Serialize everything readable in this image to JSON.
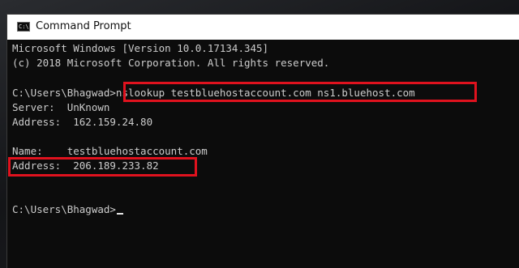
{
  "window": {
    "title": "Command Prompt",
    "icon": "command-prompt-icon"
  },
  "console": {
    "lines": [
      "Microsoft Windows [Version 10.0.17134.345]",
      "(c) 2018 Microsoft Corporation. All rights reserved.",
      "",
      "C:\\Users\\Bhagwad>nslookup testbluehostaccount.com ns1.bluehost.com",
      "Server:  UnKnown",
      "Address:  162.159.24.80",
      "",
      "Name:    testbluehostaccount.com",
      "Address:  206.189.233.82",
      "",
      "",
      "C:\\Users\\Bhagwad>"
    ],
    "header_version": "Microsoft Windows [Version 10.0.17134.345]",
    "header_copyright": "(c) 2018 Microsoft Corporation. All rights reserved.",
    "prompt_command": "C:\\Users\\Bhagwad>nslookup testbluehostaccount.com ns1.bluehost.com",
    "server_line": "Server:  UnKnown",
    "server_address_line": "Address:  162.159.24.80",
    "name_line": "Name:    testbluehostaccount.com",
    "result_address_line": "Address:  206.189.233.82",
    "final_prompt": "C:\\Users\\Bhagwad>"
  },
  "colors": {
    "console_bg": "#0c0c0c",
    "console_text": "#cccccc",
    "highlight": "#e0121e",
    "titlebar_bg": "#ffffff"
  }
}
